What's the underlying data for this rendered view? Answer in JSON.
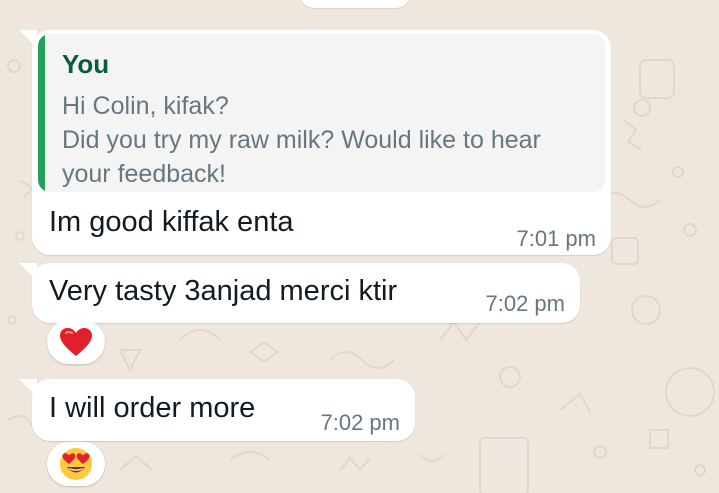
{
  "conversation": {
    "messages": [
      {
        "reply_to": {
          "author": "You",
          "text": "Hi Colin, kifak?\nDid you try my raw milk? Would like to hear your feedback!"
        },
        "text": "Im good kiffak enta",
        "time": "7:01 pm"
      },
      {
        "text": "Very tasty 3anjad merci ktir",
        "time": "7:02 pm",
        "reaction": "red-heart-icon"
      },
      {
        "text": "I will order more",
        "time": "7:02 pm",
        "reaction": "heart-eyes-face-icon"
      }
    ]
  },
  "theme": {
    "chat_background": "#efe7dd",
    "bubble_background": "#ffffff",
    "quote_background": "#f4f4f4",
    "quote_accent": "#25a25a",
    "quote_author_color": "#0d5c3a",
    "secondary_text": "#667781",
    "primary_text": "#111b21"
  }
}
